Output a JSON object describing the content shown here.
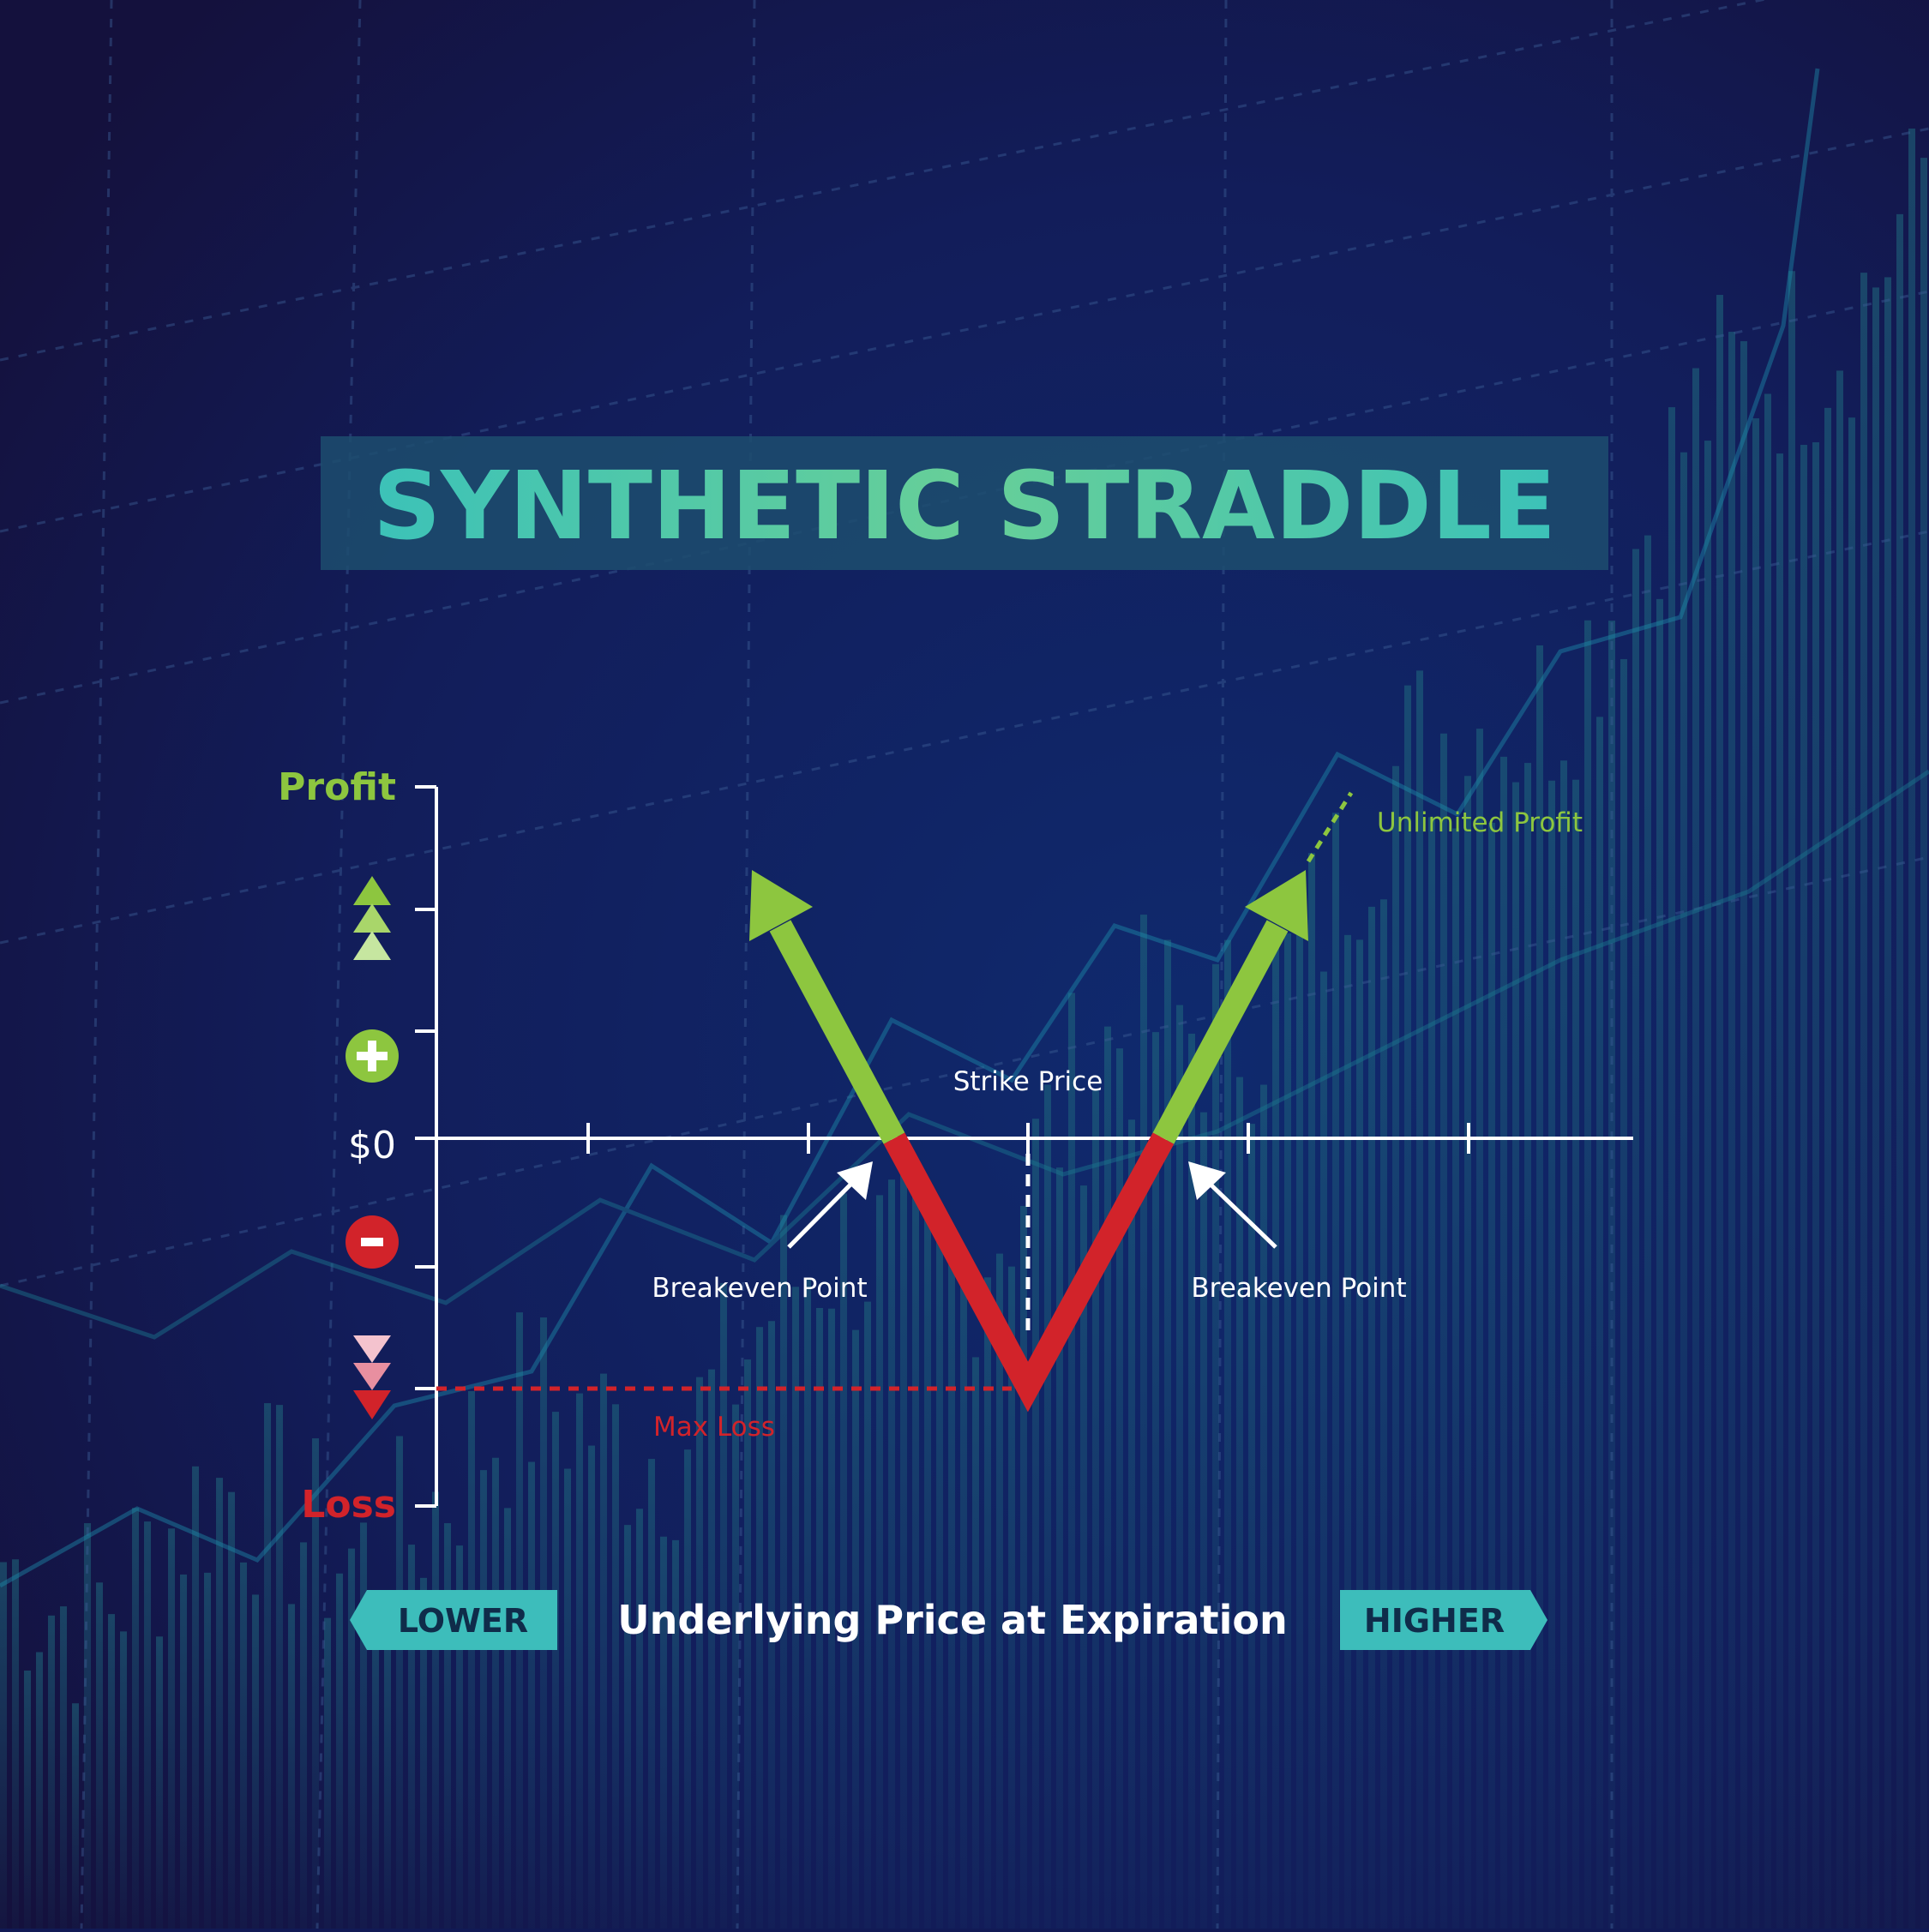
{
  "title": "SYNTHETIC STRADDLE",
  "y_axis": {
    "top_label": "Profit",
    "zero_label": "$0",
    "bottom_label": "Loss"
  },
  "x_axis": {
    "label": "Underlying Price at Expiration",
    "left_tag": "LOWER",
    "right_tag": "HIGHER"
  },
  "annotations": {
    "strike": "Strike Price",
    "breakeven_left": "Breakeven Point",
    "breakeven_right": "Breakeven Point",
    "unlimited_profit": "Unlimited Profit",
    "max_loss": "Max Loss"
  },
  "icons": {
    "profit_stack": "triangle-up-stack-icon",
    "plus": "plus-circle-icon",
    "minus": "minus-circle-icon",
    "loss_stack": "triangle-down-stack-icon"
  },
  "colors": {
    "background": "#111a55",
    "title": "#49c9b0",
    "title_band": "#1d4d6f",
    "profit": "#8dc63f",
    "loss": "#d2232a",
    "axis": "#ffffff",
    "tag": "#3dbdbb",
    "tag_text": "#0f2c4a"
  }
}
